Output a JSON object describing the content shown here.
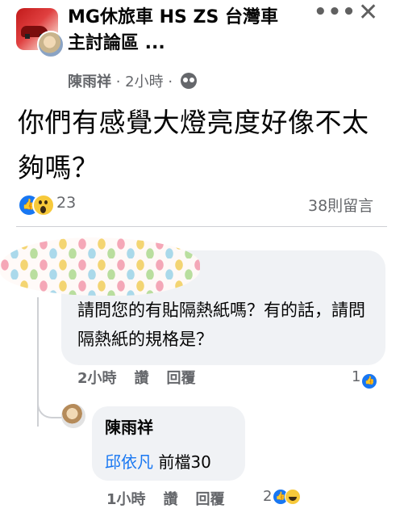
{
  "header": {
    "group_title": "MG休旅車 HS ZS 台灣車 主討論區 ...",
    "more_icon": "•••",
    "close_icon": "✕",
    "author": "陳雨祥",
    "time": " · 2小時 · "
  },
  "post": {
    "text": "你們有感覺大燈亮度好像不太夠嗎？",
    "reaction_count": "23",
    "comment_count": "38則留言"
  },
  "comments": [
    {
      "text": "請問您的有貼隔熱紙嗎？有的話，請問隔熱紙的規格是？",
      "time": "2小時",
      "like_label": "讚",
      "reply_label": "回覆",
      "reaction_count": "1"
    }
  ],
  "reply": {
    "author": "陳雨祥",
    "mention": "邱依凡",
    "body": " 前檔30",
    "time": "1小時",
    "like_label": "讚",
    "reply_label": "回覆",
    "reaction_count": "2"
  },
  "colors": {
    "accent": "#1877f2",
    "secondary_text": "#65676b",
    "bubble": "#f0f2f5"
  },
  "icons": [
    "more-icon",
    "close-icon",
    "audience-icon",
    "like-reaction-icon",
    "wow-reaction-icon",
    "haha-reaction-icon"
  ]
}
